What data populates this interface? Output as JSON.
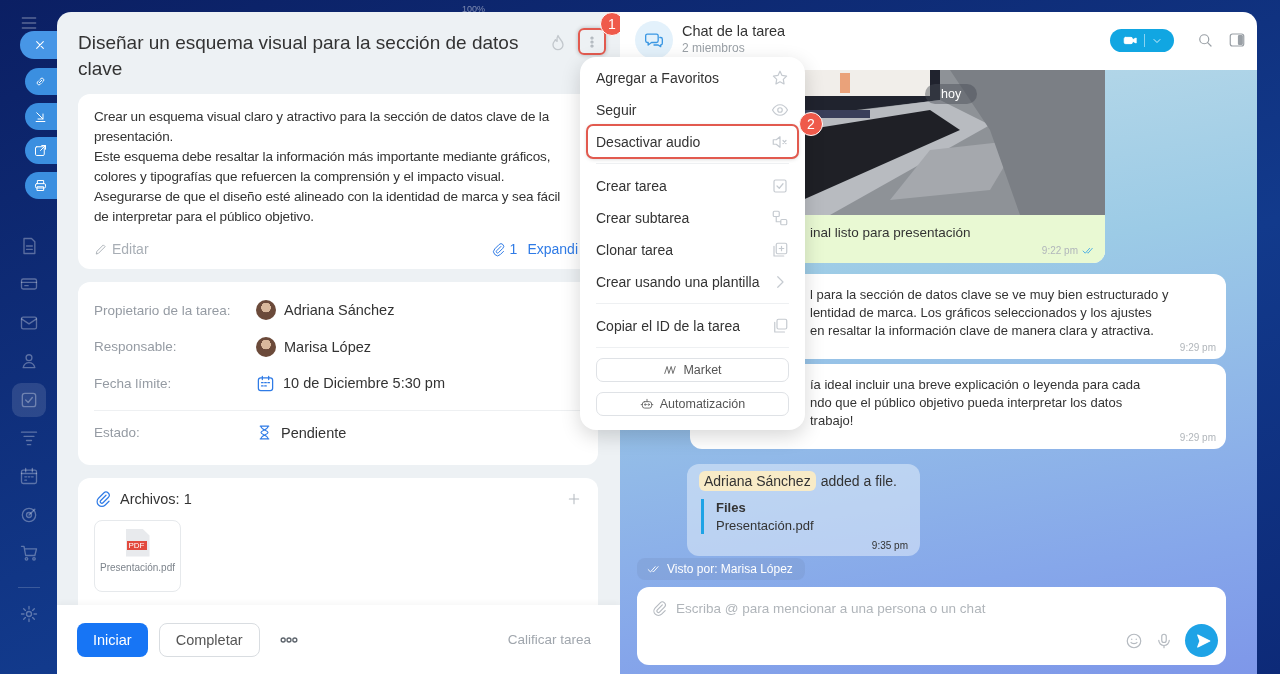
{
  "zoom_label": "100%",
  "task": {
    "title": "Diseñar un esquema visual para la sección de datos clave",
    "more_button": {
      "highlighted": true,
      "badge": "1"
    },
    "description": [
      "Crear un esquema visual claro y atractivo para la sección de datos clave de la presentación.",
      "Este esquema debe resaltar la información más importante mediante gráficos, colores y tipografías que refuercen la comprensión y el impacto visual.",
      "Asegurarse de que el diseño esté alineado con la identidad de marca y sea fácil de interpretar para el público objetivo."
    ],
    "edit_label": "Editar",
    "attachment_count": "1",
    "expand_label": "Expandi",
    "fields": [
      {
        "kind": "person",
        "label": "Propietario de la tarea:",
        "value": "Adriana Sánchez"
      },
      {
        "kind": "person",
        "label": "Responsable:",
        "value": "Marisa López"
      },
      {
        "kind": "date",
        "label": "Fecha límite:",
        "value": "10 de Diciembre 5:30 pm"
      },
      {
        "kind": "status",
        "label": "Estado:",
        "value": "Pendiente"
      }
    ],
    "files": {
      "title": "Archivos: 1",
      "items": [
        {
          "name": "Presentación.pdf",
          "type": "PDF"
        }
      ]
    },
    "buttons": {
      "primary": "Iniciar",
      "secondary": "Completar",
      "rate": "Calificar tarea"
    }
  },
  "menu": {
    "groups": [
      [
        {
          "label": "Agregar a Favoritos",
          "highlighted": false
        },
        {
          "label": "Seguir",
          "highlighted": false
        },
        {
          "label": "Desactivar audio",
          "highlighted": true,
          "badge": "2"
        }
      ],
      [
        {
          "label": "Crear tarea",
          "highlighted": false
        },
        {
          "label": "Crear subtarea",
          "highlighted": false
        },
        {
          "label": "Clonar tarea",
          "highlighted": false
        },
        {
          "label": "Crear usando una plantilla",
          "highlighted": false
        }
      ],
      [
        {
          "label": "Copiar el ID de la tarea",
          "highlighted": false
        }
      ]
    ],
    "buttons": [
      "Market",
      "Automatización"
    ]
  },
  "chat": {
    "title": "Chat de la tarea",
    "subtitle": "2 miembros",
    "date_label": "hoy",
    "messages": [
      {
        "lines": [
          "inal listo para presentación"
        ],
        "time": "9:22 pm",
        "read": true
      },
      {
        "kind": "text",
        "lines": [
          "l para la sección de datos clave se ve muy bien estructurado y",
          "lentidad de marca. Los gráficos seleccionados y los ajustes",
          "en resaltar la información clave de manera clara y atractiva."
        ],
        "time": "9:29 pm",
        "read": false
      },
      {
        "kind": "text",
        "lines": [
          "ía ideal incluir una breve explicación o leyenda para cada",
          "ndo que el público objetivo pueda interpretar los datos",
          "trabajo!"
        ],
        "time": "9:29 pm",
        "read": false
      },
      {
        "kind": "file",
        "author": "Adriana Sánchez",
        "action": "added a file.",
        "quote_title": "Files",
        "file": "Presentación.pdf",
        "time": "9:35 pm"
      }
    ],
    "seen": "Visto por: Marisa López",
    "placeholder": "Escriba @ para mencionar a una persona o un chat"
  }
}
